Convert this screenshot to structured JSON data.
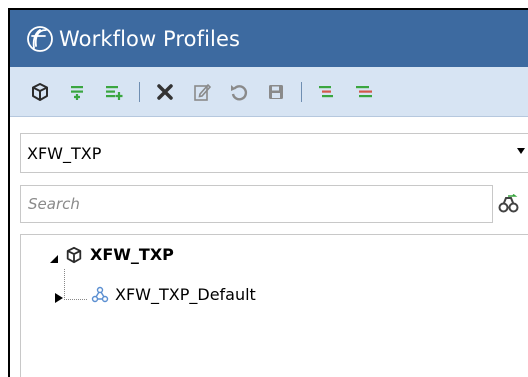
{
  "window": {
    "title": "Workflow Profiles"
  },
  "toolbar": {
    "buttons": [
      {
        "name": "cube-icon"
      },
      {
        "name": "add-sibling-icon"
      },
      {
        "name": "add-child-icon"
      },
      {
        "name": "delete-icon"
      },
      {
        "name": "edit-icon"
      },
      {
        "name": "refresh-icon"
      },
      {
        "name": "save-icon"
      },
      {
        "name": "collapse-icon"
      },
      {
        "name": "expand-icon"
      }
    ]
  },
  "profile_select": {
    "value": "XFW_TXP"
  },
  "search": {
    "placeholder": "Search"
  },
  "tree": {
    "root": {
      "label": "XFW_TXP",
      "expanded": true
    },
    "children": [
      {
        "label": "XFW_TXP_Default",
        "expanded": false
      }
    ]
  },
  "colors": {
    "titlebar": "#3d6aa0",
    "toolbar": "#d7e4f3",
    "accent_green": "#3aa640",
    "icon_dark": "#3a3a3a"
  }
}
